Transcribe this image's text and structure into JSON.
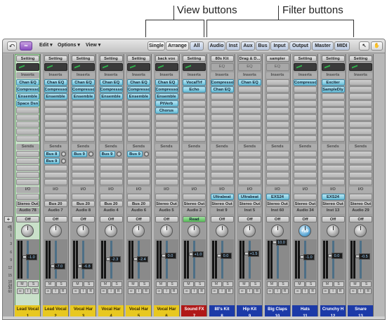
{
  "callouts": {
    "view_buttons": "View buttons",
    "filter_buttons": "Filter buttons"
  },
  "toolbar": {
    "edit": "Edit ▾",
    "options": "Options ▾",
    "view": "View ▾",
    "view_buttons": [
      "Single",
      "Arrange",
      "All"
    ],
    "filter_buttons": [
      "Audio",
      "Inst",
      "Aux",
      "Bus",
      "Input",
      "Output",
      "Master",
      "MIDI"
    ]
  },
  "labels": {
    "setting": "Setting",
    "inserts": "Inserts",
    "sends": "Sends",
    "io": "I/O",
    "eq": "EQ",
    "off": "Off",
    "read": "Read"
  },
  "scale": [
    "dB",
    "0",
    "1",
    "3",
    "6",
    "9",
    "12",
    "15",
    "18",
    "24",
    "30",
    "60"
  ],
  "strips": [
    {
      "setting": "Setting",
      "inserts": [
        "Chan EQ",
        "Compresso",
        "Ensemble",
        "Space Dsn"
      ],
      "sends": [],
      "input": "",
      "output": "Stereo Out",
      "name2": "Audio 78",
      "auto": "Off",
      "db": "-1.0",
      "name": "Lead Vocal",
      "num": "1",
      "color": "#e8c820"
    },
    {
      "setting": "Setting",
      "inserts": [
        "Chan EQ",
        "Compresso",
        "Ensemble"
      ],
      "sends": [
        "Bus 8",
        "Bus 9"
      ],
      "input": "",
      "output": "Bus 20",
      "name2": "Audio 7",
      "auto": "Off",
      "db": "-7.0",
      "name": "Lead Vocal",
      "num": "2",
      "color": "#e8c820"
    },
    {
      "setting": "Setting",
      "inserts": [
        "Chan EQ",
        "Compresso",
        "Ensemble"
      ],
      "sends": [
        "Bus 9"
      ],
      "input": "",
      "output": "Bus 20",
      "name2": "Audio 8",
      "auto": "Off",
      "db": "-6.8",
      "name": "Vocal Har",
      "num": "3",
      "color": "#e8c820"
    },
    {
      "setting": "Setting",
      "inserts": [
        "Chan EQ",
        "Compresso",
        "Ensemble"
      ],
      "sends": [
        "Bus 9"
      ],
      "input": "",
      "output": "Bus 20",
      "name2": "Audio 4",
      "auto": "Off",
      "db": "-2.3",
      "name": "Vocal Har",
      "num": "4",
      "color": "#e8c820"
    },
    {
      "setting": "Setting",
      "inserts": [
        "Chan EQ",
        "Compresso",
        "Ensemble"
      ],
      "sends": [
        "Bus 9"
      ],
      "input": "",
      "output": "Bus 20",
      "name2": "Audio 6",
      "auto": "Off",
      "db": "-2.4",
      "name": "Vocal Har",
      "num": "5",
      "color": "#e8c820"
    },
    {
      "setting": "back vox",
      "inserts": [
        "Chan EQ",
        "Compresso",
        "Ensemble",
        "PtVerb",
        "Chorus"
      ],
      "sends": [],
      "input": "",
      "output": "Stereo Out",
      "name2": "Audio 5",
      "auto": "Off",
      "db": "0.0",
      "name": "Vocal Har",
      "num": "6",
      "color": "#e8c820"
    },
    {
      "setting": "Setting",
      "inserts": [
        "VocalTrf",
        "Echo"
      ],
      "sends": [],
      "input": "",
      "output": "Stereo Out",
      "name2": "Audio 2",
      "auto": "Read",
      "db": "+1.0",
      "name": "Sound FX",
      "num": "7",
      "color": "#b01818"
    },
    {
      "setting": "80s Kit",
      "inserts": [
        "Compresso",
        "Chan EQ"
      ],
      "sends": [],
      "input": "Ultrabeat",
      "output": "Stereo Out",
      "name2": "Inst 9",
      "auto": "Off",
      "db": "0.0",
      "name": "80's Kit",
      "num": "8",
      "color": "#1c3aa8"
    },
    {
      "setting": "Drag & D...",
      "inserts": [
        "Chan EQ"
      ],
      "sends": [],
      "input": "Ultrabeat",
      "output": "Stereo Out",
      "name2": "Inst 5",
      "auto": "Off",
      "db": "+1.5",
      "name": "Hip Kit",
      "num": "9",
      "color": "#1c3aa8"
    },
    {
      "setting": "sampler",
      "inserts": [],
      "sends": [],
      "input": "EXS24",
      "output": "Stereo Out",
      "name2": "Inst 60",
      "auto": "Off",
      "db": "10.0",
      "name": "Big Claps",
      "num": "10",
      "color": "#1c3aa8"
    },
    {
      "setting": "Setting",
      "inserts": [
        "Compresso"
      ],
      "sends": [],
      "input": "",
      "output": "Stereo Out",
      "name2": "Audio 34",
      "auto": "Off",
      "db": "-1.0",
      "name": "Hats",
      "num": "11",
      "color": "#1c3aa8",
      "pan": "+19"
    },
    {
      "setting": "Setting",
      "inserts": [
        "Exciter",
        "SampleDly"
      ],
      "sends": [],
      "input": "EXS24",
      "output": "Stereo Out",
      "name2": "Inst 13",
      "auto": "Off",
      "db": "0.0",
      "name": "Crunchy H",
      "num": "12",
      "color": "#1c3aa8"
    },
    {
      "setting": "Setting",
      "inserts": [],
      "sends": [],
      "input": "",
      "output": "Stereo Out",
      "name2": "Audio 29",
      "auto": "Off",
      "db": "-0.5",
      "name": "Snare",
      "num": "13",
      "color": "#1c3aa8"
    }
  ]
}
